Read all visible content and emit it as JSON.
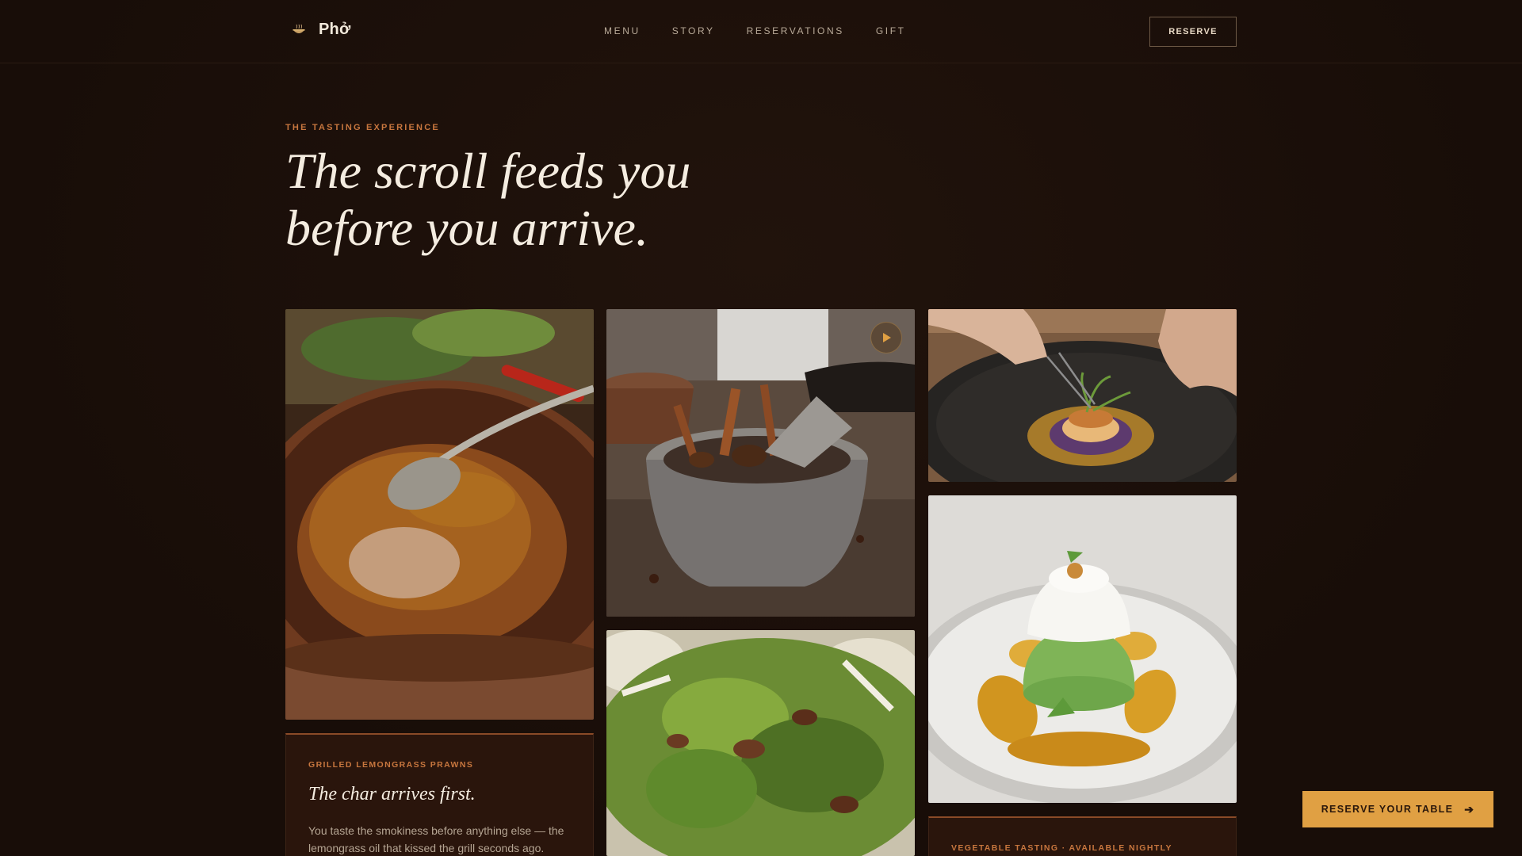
{
  "brand": {
    "name": "Phở",
    "logo_icon": "bowl-icon"
  },
  "nav": {
    "links": [
      "MENU",
      "STORY",
      "RESERVATIONS",
      "GIFT"
    ],
    "reserve_label": "RESERVE"
  },
  "hero": {
    "eyebrow": "THE TASTING EXPERIENCE",
    "title_line1": "The scroll feeds you",
    "title_line2": "before you arrive."
  },
  "gallery": {
    "cards": [
      {
        "eyebrow": "GRILLED LEMONGRASS PRAWNS",
        "title": "The char arrives first.",
        "body": "You taste the smokiness before anything else — the lemongrass oil that kissed the grill seconds ago."
      },
      {
        "eyebrow": "VEGETABLE TASTING · AVAILABLE NIGHTLY"
      }
    ],
    "play_icon": "play-icon"
  },
  "cta": {
    "label": "RESERVE YOUR TABLE",
    "icon": "arrow-right-icon"
  },
  "colors": {
    "background": "#1a0e09",
    "accent": "#c7763e",
    "cta": "#e0a043"
  }
}
